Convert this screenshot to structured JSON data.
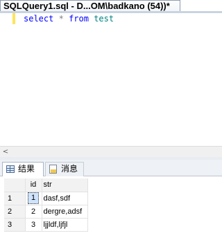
{
  "document_tab": {
    "title": "SQLQuery1.sql - D...OM\\badkano (54))*"
  },
  "editor": {
    "code": {
      "keyword_select": "select",
      "star": "*",
      "keyword_from": "from",
      "table": "test"
    },
    "colors": {
      "keyword": "#0000ff",
      "operator": "#808080",
      "identifier": "#008080",
      "change_marker": "#ffe45c"
    }
  },
  "scrollbar": {
    "left_arrow": "<"
  },
  "results_tabs": [
    {
      "label": "结果",
      "icon": "grid-icon",
      "active": true
    },
    {
      "label": "消息",
      "icon": "message-icon",
      "active": false
    }
  ],
  "results_grid": {
    "columns": [
      "id",
      "str"
    ],
    "rows": [
      {
        "rownum": "1",
        "id": "1",
        "str": "dasf,sdf"
      },
      {
        "rownum": "2",
        "id": "2",
        "str": "dergre,adsf"
      },
      {
        "rownum": "3",
        "id": "3",
        "str": "ljjldf,ljfjl"
      }
    ]
  }
}
